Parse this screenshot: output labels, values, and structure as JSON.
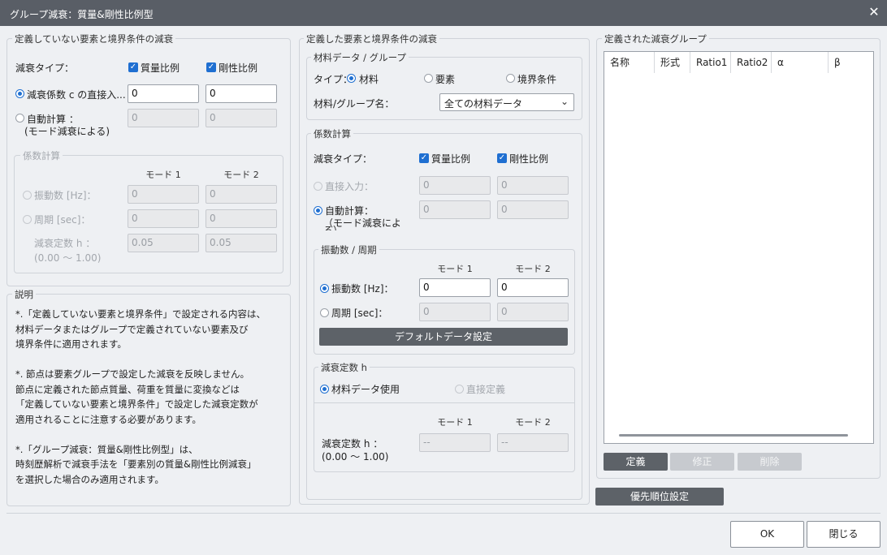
{
  "window": {
    "title": "グループ減衰：質量&剛性比例型",
    "close_icon": "close-icon"
  },
  "left": {
    "group_title": "定義していない要素と境界条件の減衰",
    "damping_type_label": "減衰タイプ：",
    "mass_label": "質量比例",
    "stiff_label": "剛性比例",
    "direct_label": "減衰係数 c の直接入...",
    "direct_v1": "0",
    "direct_v2": "0",
    "auto_label": "自動計算 ：",
    "auto_sub": "(モード減衰による)",
    "auto_v1": "0",
    "auto_v2": "0",
    "coef": {
      "title": "係数計算",
      "mode1": "モード 1",
      "mode2": "モード 2",
      "freq_label": "振動数 [Hz]：",
      "freq_v1": "0",
      "freq_v2": "0",
      "period_label": "周期 [sec]：",
      "period_v1": "0",
      "period_v2": "0",
      "h_label": "減衰定数 h ：",
      "h_range": "(0.00 ～ 1.00)",
      "h_v1": "0.05",
      "h_v2": "0.05"
    }
  },
  "explain": {
    "title": "説明",
    "lines": [
      "*.「定義していない要素と境界条件」で設定される内容は、",
      "材料データまたはグループで定義されていない要素及び",
      "境界条件に適用されます。",
      "",
      "*. 節点は要素グループで設定した減衰を反映しません。",
      "節点に定義された節点質量、荷重を質量に変換などは",
      "「定義していない要素と境界条件」で設定した減衰定数が",
      "適用されることに注意する必要があります。",
      "",
      "*.「グループ減衰：質量&剛性比例型」は、",
      "時刻歴解析で減衰手法を「要素別の質量&剛性比例減衰」",
      "を選択した場合のみ適用されます。"
    ]
  },
  "middle": {
    "group_title": "定義した要素と境界条件の減衰",
    "material": {
      "title": "材料データ / グループ",
      "type_label": "タイプ：",
      "opt_material": "材料",
      "opt_element": "要素",
      "opt_boundary": "境界条件",
      "name_label": "材料/グループ名：",
      "select_value": "全ての材料データ"
    },
    "coef": {
      "title": "係数計算",
      "damping_type_label": "減衰タイプ：",
      "mass_label": "質量比例",
      "stiff_label": "剛性比例",
      "direct_label": "直接入力：",
      "direct_v1": "0",
      "direct_v2": "0",
      "auto_label": "自動計算：",
      "auto_sub": "（モード減衰によ",
      "auto_sub2": "る）",
      "auto_v1": "0",
      "auto_v2": "0"
    },
    "freq": {
      "title": "振動数 / 周期",
      "mode1": "モード 1",
      "mode2": "モード 2",
      "freq_label": "振動数 [Hz]：",
      "freq_v1": "0",
      "freq_v2": "0",
      "period_label": "周期 [sec]：",
      "period_v1": "0",
      "period_v2": "0",
      "default_button": "デフォルトデータ設定"
    },
    "hconst": {
      "title": "減衰定数 h",
      "opt_material": "材料データ使用",
      "opt_direct": "直接定義",
      "mode1": "モード 1",
      "mode2": "モード 2",
      "h_label": "減衰定数 h ：",
      "h_range": "(0.00 ～ 1.00)",
      "h_v1": "--",
      "h_v2": "--"
    }
  },
  "right": {
    "group_title": "定義された減衰グループ",
    "columns": [
      "名称",
      "形式",
      "Ratio1",
      "Ratio2",
      "α",
      "β"
    ],
    "define_button": "定義",
    "modify_button": "修正",
    "delete_button": "削除",
    "priority_button": "優先順位設定"
  },
  "footer": {
    "ok_button": "OK",
    "close_button": "閉じる"
  }
}
